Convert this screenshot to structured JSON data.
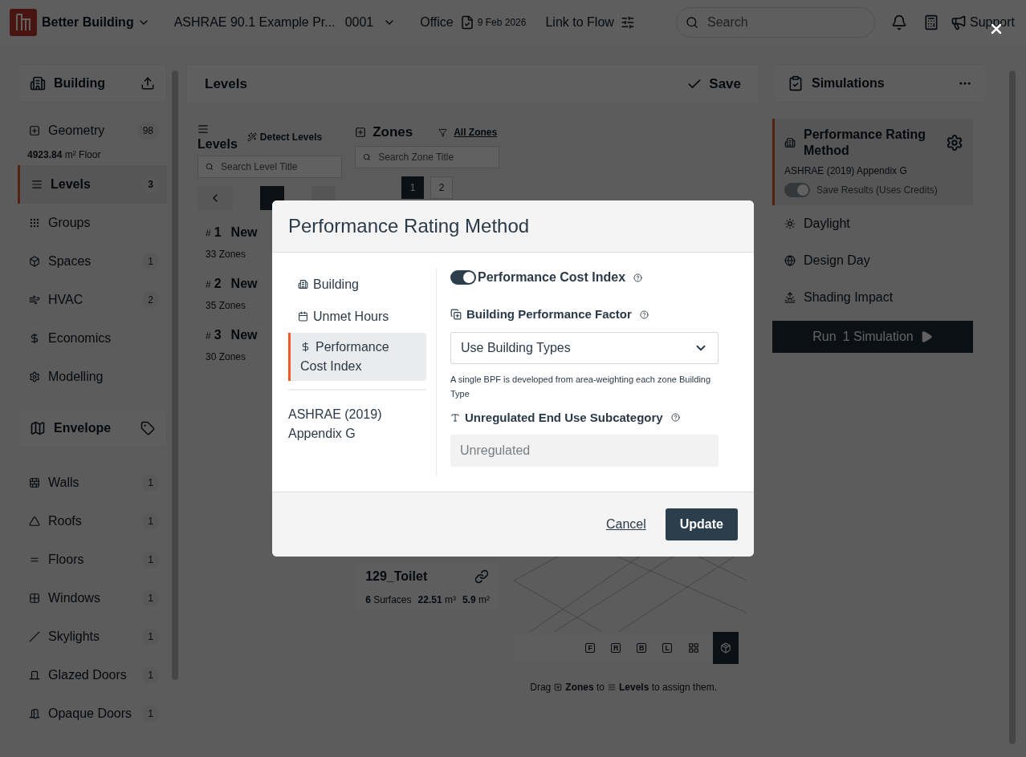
{
  "top_bar": {
    "app_name": "Better Building",
    "project_name": "ASHRAE 90.1 Example Pr...",
    "project_number": "0001",
    "building_type": "Office",
    "date": "9 Feb 2026",
    "link_label": "Link to Flow",
    "search_placeholder": "Search",
    "support_label": "Support"
  },
  "sidebar": {
    "sections": [
      {
        "title": "Building",
        "items": [
          {
            "label": "Geometry",
            "count": "98",
            "sub": "**4923.84** m² Floor",
            "selected": false
          },
          {
            "label": "Levels",
            "count": "3",
            "selected": true
          },
          {
            "label": "Groups",
            "selected": false
          },
          {
            "label": "Spaces",
            "count": "1",
            "selected": false
          },
          {
            "label": "HVAC",
            "count": "2",
            "selected": false
          },
          {
            "label": "Economics",
            "selected": false
          },
          {
            "label": "Modelling",
            "selected": false
          }
        ]
      },
      {
        "title": "Envelope",
        "items": [
          {
            "label": "Walls",
            "count": "1",
            "selected": false
          },
          {
            "label": "Roofs",
            "count": "1",
            "selected": false
          },
          {
            "label": "Floors",
            "count": "1",
            "selected": false
          },
          {
            "label": "Windows",
            "count": "1",
            "selected": false
          },
          {
            "label": "Skylights",
            "count": "1",
            "selected": false
          },
          {
            "label": "Glazed Doors",
            "count": "1",
            "selected": false
          },
          {
            "label": "Opaque Doors",
            "count": "1",
            "selected": false
          }
        ]
      }
    ]
  },
  "levels_panel": {
    "title": "Levels",
    "save_label": "Save",
    "levels_column": {
      "title": "Levels",
      "detect_label": "Detect Levels",
      "search_placeholder": "Search Level Title",
      "pager": [
        {
          "selected": true
        },
        {
          "selected": false
        }
      ],
      "levels": [
        {
          "prefix": "#",
          "number": "1",
          "name": "New",
          "zones": "33 Zones"
        },
        {
          "prefix": "#",
          "number": "2",
          "name": "New",
          "zones": "35 Zones"
        },
        {
          "prefix": "#",
          "number": "3",
          "name": "New",
          "zones": "30 Zones"
        }
      ]
    },
    "zones_column": {
      "title": "Zones",
      "filter_label": "All Zones",
      "search_placeholder": "Search Zone Title",
      "pager": [
        {
          "label": "1",
          "selected": true
        },
        {
          "label": "2",
          "selected": false
        }
      ],
      "zone_card": {
        "name": "129_Toilet",
        "surfaces": "**6** Surfaces",
        "volume": "**22.51** m³",
        "area": "**5.9** m²"
      }
    },
    "view_buttons": [
      {
        "kind": "letter",
        "label": "F",
        "selected": false
      },
      {
        "kind": "letter",
        "label": "R",
        "selected": false
      },
      {
        "kind": "letter",
        "label": "B",
        "selected": false
      },
      {
        "kind": "letter",
        "label": "L",
        "selected": false
      },
      {
        "kind": "plan",
        "selected": false
      },
      {
        "kind": "cube",
        "selected": true
      }
    ],
    "hint": {
      "start": "Drag",
      "middle": "**Zones** to",
      "end": "**Levels** to assign them."
    }
  },
  "simulations": {
    "title": "Simulations",
    "items": [
      {
        "kind": "card",
        "title": "Performance Rating Method",
        "subtitle": "ASHRAE (2019) Appendix G",
        "toggle_label": "Save Results (Uses Credits)",
        "toggle_on": true,
        "selected": true
      },
      {
        "kind": "item",
        "label": "Daylight",
        "selected": false
      },
      {
        "kind": "item",
        "label": "Design Day",
        "selected": false
      },
      {
        "kind": "item",
        "label": "Shading Impact",
        "selected": false
      }
    ],
    "run_label": "Run",
    "run_count": "1 Simulation"
  },
  "modal": {
    "title": "Performance Rating Method",
    "nav": [
      {
        "label": "Building",
        "selected": false
      },
      {
        "label": "Unmet Hours",
        "selected": false
      },
      {
        "label": "Performance Cost Index",
        "selected": true
      }
    ],
    "standard": "ASHRAE (2019) Appendix G",
    "pci": {
      "label": "Performance Cost Index",
      "on": true
    },
    "bpf": {
      "label": "Building Performance Factor",
      "value": "Use Building Types",
      "hint": "A single BPF is developed from area-weighting each zone Building Type"
    },
    "unregulated": {
      "label": "Unregulated End Use Subcategory",
      "value": "Unregulated",
      "disabled": true
    },
    "cancel_label": "Cancel",
    "update_label": "Update"
  }
}
